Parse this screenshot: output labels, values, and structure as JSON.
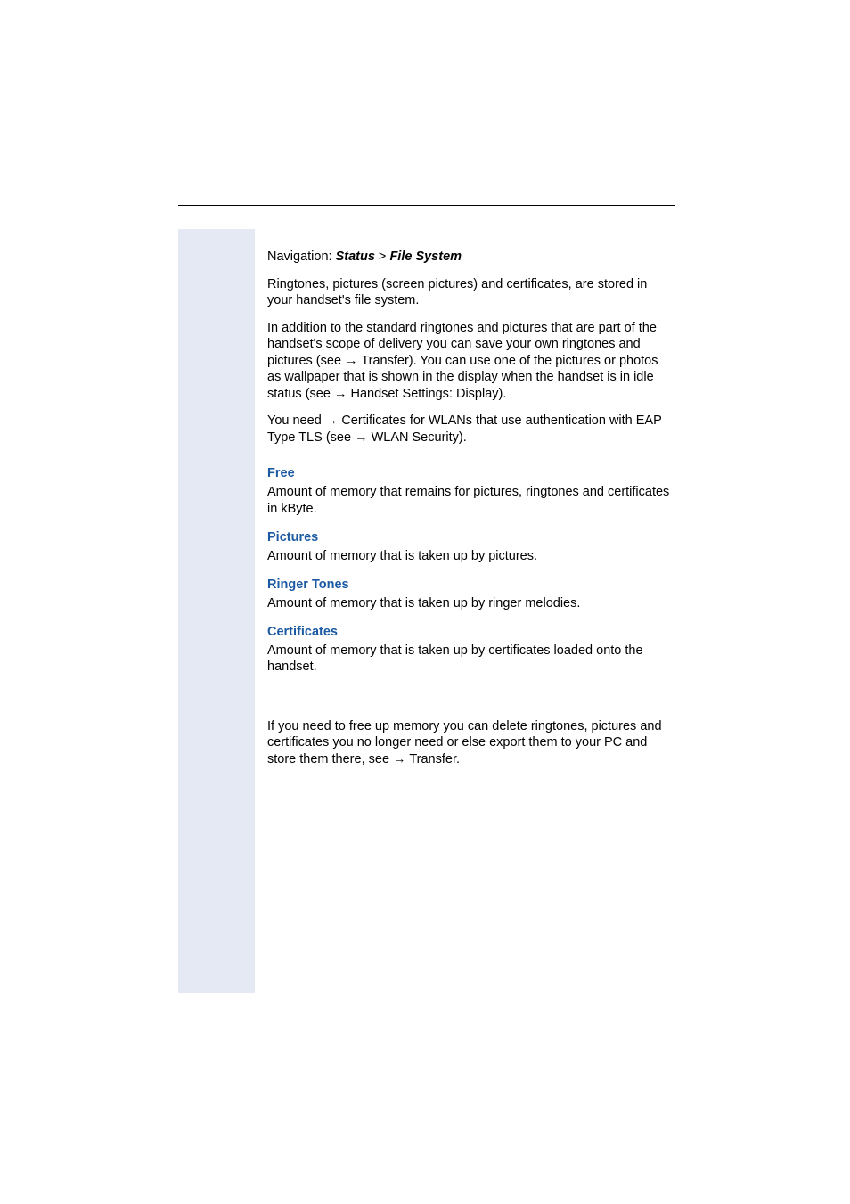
{
  "navigation": {
    "prefix": "Navigation: ",
    "path1": "Status",
    "sep": " > ",
    "path2": "File System"
  },
  "intro": {
    "p1": "Ringtones, pictures (screen pictures) and certificates, are stored in your handset's file system.",
    "p2_a": "In addition to the standard ringtones and pictures that are part of the handset's scope of delivery you can save your own ringtones and pictures (see ",
    "p2_link1": "Transfer",
    "p2_b": "). You can use one of the pictures or photos as wallpaper that is shown in the display when the handset is in idle status (see ",
    "p2_link2": "Handset Settings: Display",
    "p2_c": ").",
    "p3_a": "You need ",
    "p3_link1": "Certificates",
    "p3_b": " for WLANs that use authentication with EAP Type TLS (see ",
    "p3_link2": "WLAN Security",
    "p3_c": ")."
  },
  "sections": {
    "free": {
      "heading": "Free",
      "text": "Amount of memory that remains for pictures, ringtones and certificates in kByte."
    },
    "pictures": {
      "heading": "Pictures",
      "text": "Amount of memory that is taken up by pictures."
    },
    "ringer": {
      "heading": "Ringer Tones",
      "text": "Amount of memory that is taken up by ringer melodies."
    },
    "certs": {
      "heading": "Certificates",
      "text": "Amount of memory that is taken up by certificates loaded onto the handset."
    }
  },
  "footer": {
    "p_a": "If you need to free up memory you can delete ringtones, pictures and certificates you no longer need or else export them to your PC and store them there, see ",
    "p_link": "Transfer",
    "p_b": "."
  },
  "glyphs": {
    "arrow": "→"
  }
}
